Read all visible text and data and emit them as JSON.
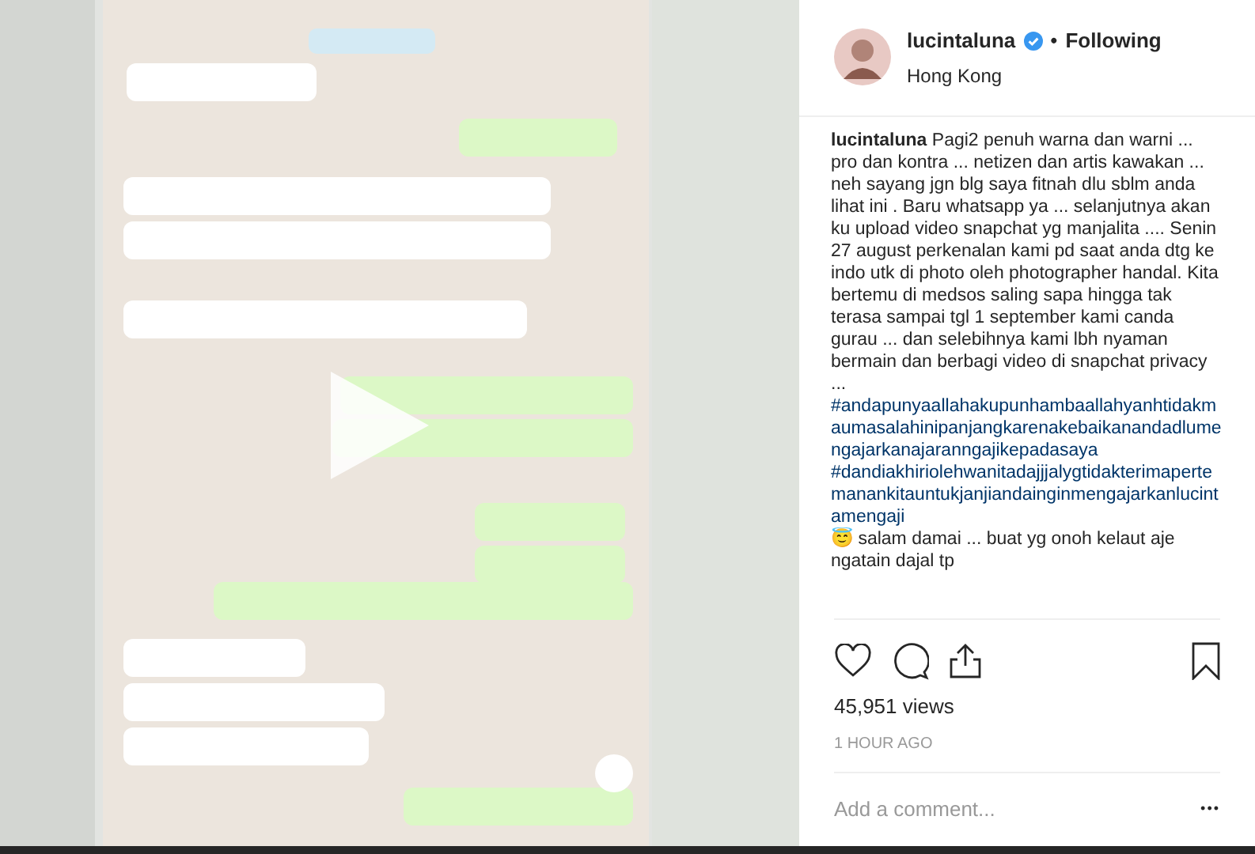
{
  "header": {
    "username": "lucintaluna",
    "verified": true,
    "separator": "•",
    "follow_label": "Following",
    "location": "Hong Kong"
  },
  "caption": {
    "segments": [
      {
        "kind": "username",
        "text": "lucintaluna"
      },
      {
        "kind": "text",
        "text": " Pagi2 penuh warna dan warni ... pro dan kontra ... netizen dan artis kawakan ... neh sayang jgn blg saya fitnah dlu sblm anda lihat ini . Baru whatsapp ya ... selanjutnya akan ku upload video snapchat yg manjalita .... Senin 27 august perkenalan kami pd saat anda dtg ke indo utk di photo oleh photographer handal. Kita bertemu di medsos saling sapa hingga tak terasa sampai tgl 1 september kami canda gurau ... dan selebihnya kami lbh nyaman bermain dan berbagi video di snapchat privacy ... "
      },
      {
        "kind": "hashtag",
        "text": "#andapunyaallahakupunhambaallahyanhtidakmaumasalahinipanjangkarenakebaikanandadlumengajarkanajaranngajikepadasaya"
      },
      {
        "kind": "hashtag",
        "text": "#dandiakhiriolehwanitadajjjalygtidakterimapertemanankitauntukjanjiandainginmengajarkanlucintamengaji"
      },
      {
        "kind": "text",
        "text": "😇 salam damai ... buat yg onoh kelaut aje ngatain dajal tp"
      }
    ]
  },
  "actions": {
    "liked": false,
    "saved": false
  },
  "views": "45,951 views",
  "time": "1 HOUR AGO",
  "comment": {
    "placeholder": "Add a comment...",
    "more": "•••"
  }
}
